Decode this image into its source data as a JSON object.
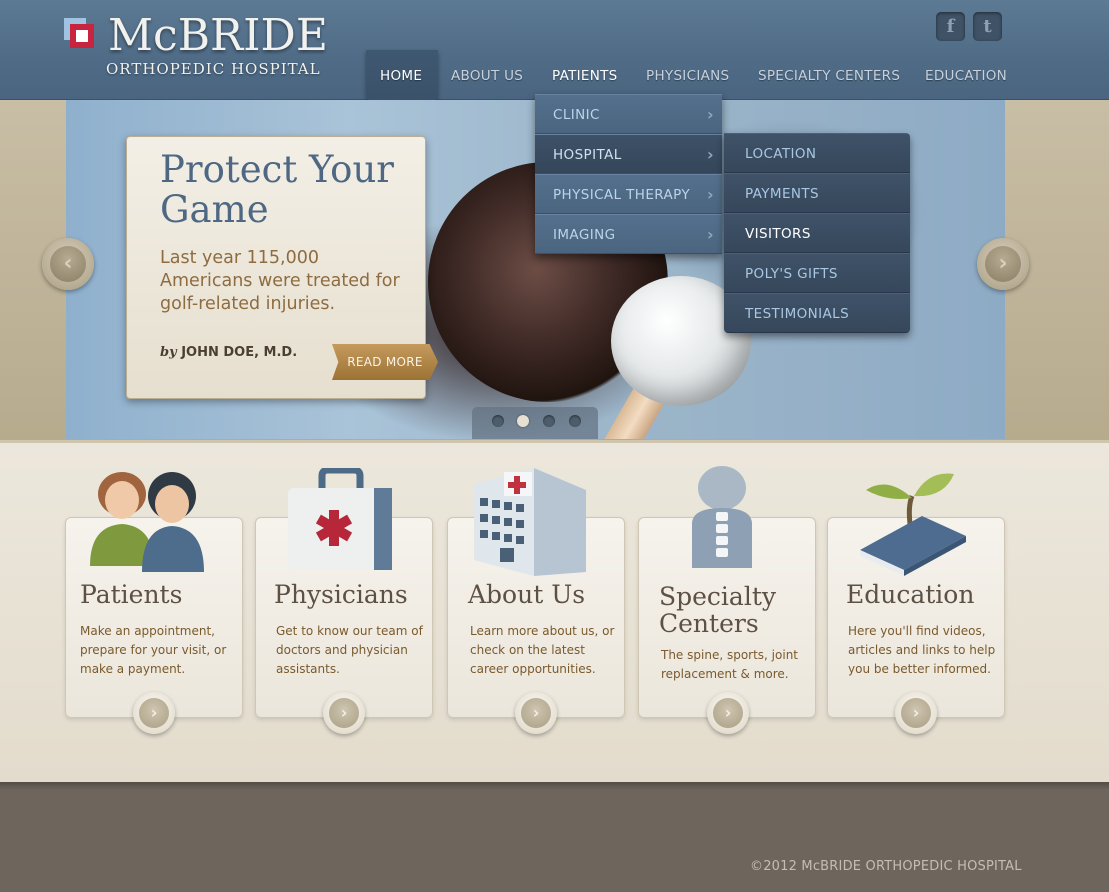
{
  "header": {
    "logo_name": "McBRIDE",
    "logo_sub": "ORTHOPEDIC HOSPITAL",
    "social": [
      {
        "icon": "facebook-icon",
        "glyph": "f"
      },
      {
        "icon": "twitter-icon",
        "glyph": "t"
      }
    ]
  },
  "nav": {
    "home": "HOME",
    "about": "ABOUT US",
    "patients": "PATIENTS",
    "physicians": "PHYSICIANS",
    "specialty": "SPECIALTY CENTERS",
    "education": "EDUCATION"
  },
  "dropdown": {
    "items": [
      {
        "label": "CLINIC"
      },
      {
        "label": "HOSPITAL"
      },
      {
        "label": "PHYSICAL THERAPY"
      },
      {
        "label": "IMAGING"
      }
    ]
  },
  "submenu": {
    "items": [
      {
        "label": "LOCATION"
      },
      {
        "label": "PAYMENTS"
      },
      {
        "label": "VISITORS"
      },
      {
        "label": "POLY'S GIFTS"
      },
      {
        "label": "TESTIMONIALS"
      }
    ]
  },
  "hero": {
    "title": "Protect Your Game",
    "text": "Last year 115,000 Americans were treated for golf-related injuries.",
    "by_prefix": "by",
    "author": "JOHN DOE, M.D.",
    "read_more": "READ MORE",
    "slide_count": 4,
    "active_slide": 2
  },
  "features": [
    {
      "title": "Patients",
      "text": "Make an appointment, prepare for your visit, or make a payment.",
      "icon": "patients-icon"
    },
    {
      "title": "Physicians",
      "text": "Get to know our team of doctors and physician assistants.",
      "icon": "medical-kit-icon"
    },
    {
      "title": "About Us",
      "text": "Learn more about us, or check on the latest career opportunities.",
      "icon": "hospital-building-icon"
    },
    {
      "title": "Specialty Centers",
      "text": "The spine, sports, joint replacement & more.",
      "icon": "spine-icon"
    },
    {
      "title": "Education",
      "text": "Here you'll find videos, articles and links to help you be better informed.",
      "icon": "book-icon"
    }
  ],
  "footer": {
    "copyright": "©2012 McBRIDE ORTHOPEDIC HOSPITAL"
  },
  "colors": {
    "header_blue": "#4f6b86",
    "hero_title": "#4e6884",
    "gold_button": "#b08447",
    "feature_text": "#7a5a2c",
    "footer_bg": "#6e665d"
  }
}
